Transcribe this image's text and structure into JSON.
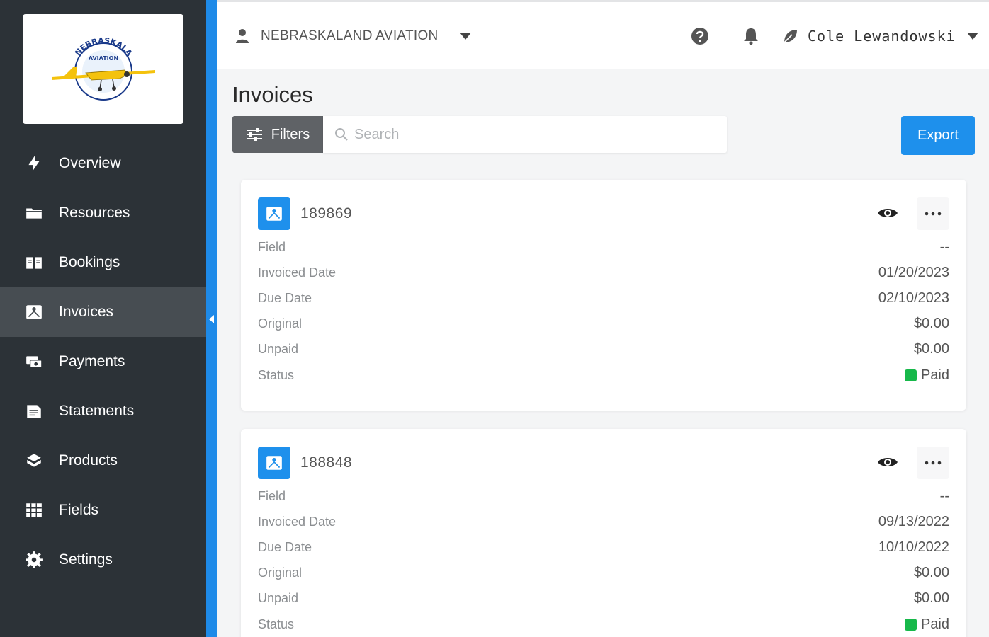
{
  "brand": {
    "logo_text_top": "NEBRASKALAND",
    "logo_text_mid": "AVIATION"
  },
  "sidebar": {
    "items": [
      {
        "label": "Overview",
        "icon": "bolt-icon"
      },
      {
        "label": "Resources",
        "icon": "folder-icon"
      },
      {
        "label": "Bookings",
        "icon": "book-icon"
      },
      {
        "label": "Invoices",
        "icon": "invoice-icon"
      },
      {
        "label": "Payments",
        "icon": "payments-icon"
      },
      {
        "label": "Statements",
        "icon": "statement-icon"
      },
      {
        "label": "Products",
        "icon": "products-icon"
      },
      {
        "label": "Fields",
        "icon": "fields-icon"
      },
      {
        "label": "Settings",
        "icon": "gear-icon"
      }
    ],
    "active": "Invoices"
  },
  "topbar": {
    "org_name": "NEBRASKALAND AVIATION",
    "user_name": "Cole Lewandowski"
  },
  "page": {
    "title": "Invoices",
    "filters_label": "Filters",
    "search_placeholder": "Search",
    "export_label": "Export"
  },
  "field_labels": {
    "field": "Field",
    "invoiced_date": "Invoiced Date",
    "due_date": "Due Date",
    "original": "Original",
    "unpaid": "Unpaid",
    "status": "Status"
  },
  "invoices": [
    {
      "number": "189869",
      "field": "--",
      "invoiced_date": "01/20/2023",
      "due_date": "02/10/2023",
      "original": "$0.00",
      "unpaid": "$0.00",
      "status": "Paid"
    },
    {
      "number": "188848",
      "field": "--",
      "invoiced_date": "09/13/2022",
      "due_date": "10/10/2022",
      "original": "$0.00",
      "unpaid": "$0.00",
      "status": "Paid"
    }
  ],
  "colors": {
    "sidebar_bg": "#2c3237",
    "sidebar_active": "#474d52",
    "accent": "#1e8ae8",
    "status_paid": "#17b84a"
  }
}
